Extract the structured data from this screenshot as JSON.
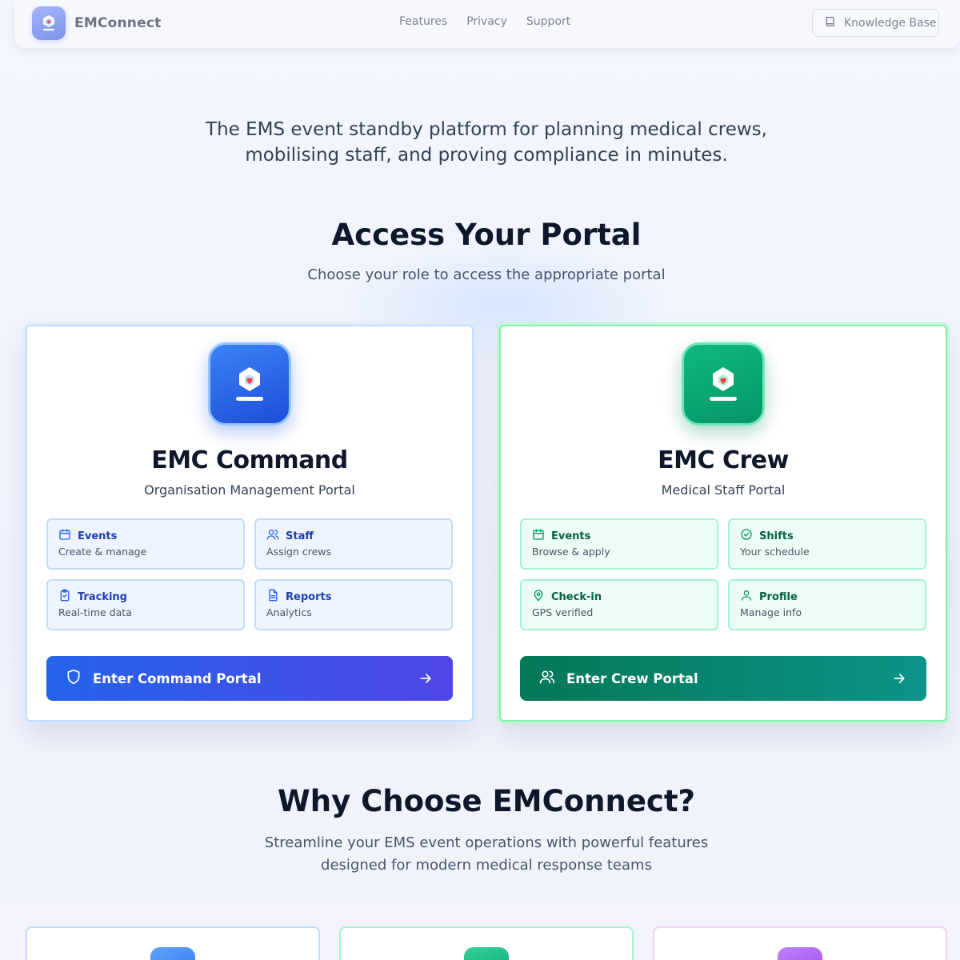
{
  "header": {
    "brand": "EMConnect",
    "nav": [
      "Features",
      "Privacy",
      "Support"
    ],
    "kb_button": "Knowledge Base"
  },
  "hero": {
    "tagline": "The EMS event standby platform for planning medical crews, mobilising staff, and proving compliance in minutes."
  },
  "portal_section": {
    "title": "Access Your Portal",
    "subtitle": "Choose your role to access the appropriate portal"
  },
  "portals": {
    "command": {
      "title": "EMC Command",
      "subtitle": "Organisation Management Portal",
      "features": [
        {
          "label": "Events",
          "desc": "Create & manage",
          "icon": "calendar-icon"
        },
        {
          "label": "Staff",
          "desc": "Assign crews",
          "icon": "users-icon"
        },
        {
          "label": "Tracking",
          "desc": "Real-time data",
          "icon": "clipboard-check-icon"
        },
        {
          "label": "Reports",
          "desc": "Analytics",
          "icon": "document-icon"
        }
      ],
      "button": "Enter Command Portal",
      "button_icon": "shield-icon",
      "accent": "#2563eb"
    },
    "crew": {
      "title": "EMC Crew",
      "subtitle": "Medical Staff Portal",
      "features": [
        {
          "label": "Events",
          "desc": "Browse & apply",
          "icon": "calendar-icon"
        },
        {
          "label": "Shifts",
          "desc": "Your schedule",
          "icon": "check-circle-icon"
        },
        {
          "label": "Check-in",
          "desc": "GPS verified",
          "icon": "map-pin-icon"
        },
        {
          "label": "Profile",
          "desc": "Manage info",
          "icon": "user-icon"
        }
      ],
      "button": "Enter Crew Portal",
      "button_icon": "users-icon",
      "accent": "#047857"
    }
  },
  "why_section": {
    "title": "Why Choose EMConnect?",
    "subtitle": "Streamline your EMS event operations with powerful features designed for modern medical response teams"
  }
}
